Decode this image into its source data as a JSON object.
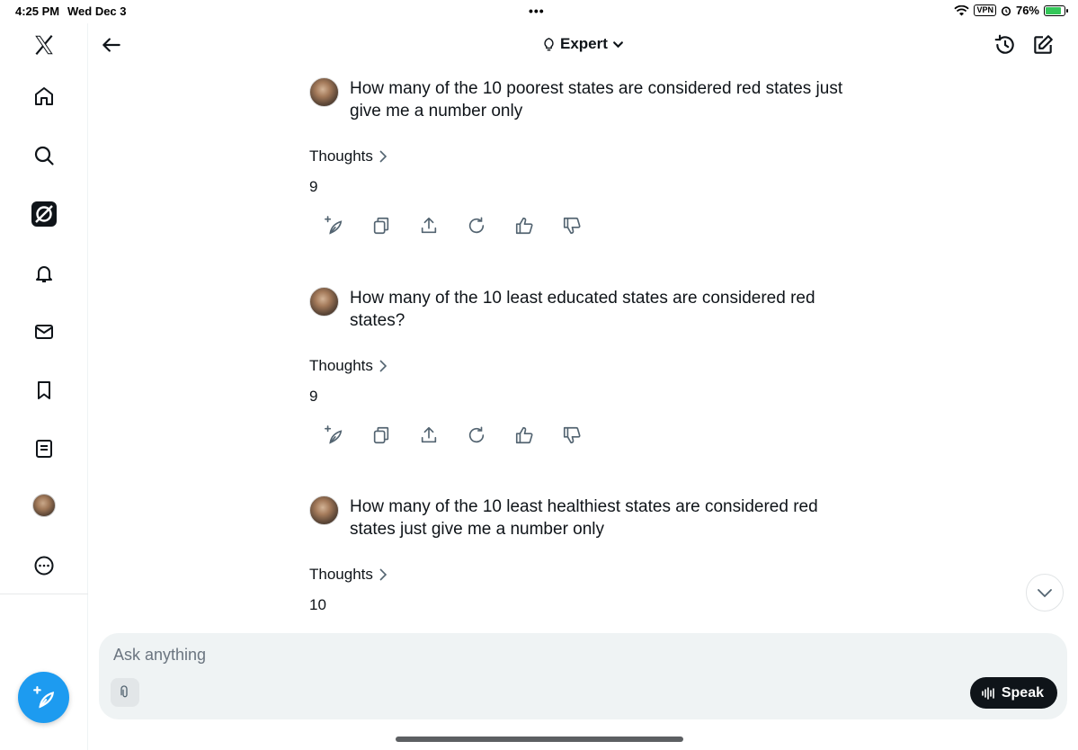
{
  "status_bar": {
    "time": "4:25 PM",
    "date": "Wed Dec 3",
    "dots": "•••",
    "vpn": "VPN",
    "battery_text": "76%",
    "battery_level": 0.76
  },
  "header": {
    "mode_label": "Expert"
  },
  "conversation": [
    {
      "question": "How many of the 10 poorest states are considered red states just give me a number only",
      "thoughts_label": "Thoughts",
      "answer": "9"
    },
    {
      "question": "How many of the 10 least educated states are considered red states?",
      "thoughts_label": "Thoughts",
      "answer": "9"
    },
    {
      "question": "How many of the 10 least healthiest states are considered red states just give me a number only",
      "thoughts_label": "Thoughts",
      "answer": "10"
    }
  ],
  "composer": {
    "placeholder": "Ask anything",
    "speak_label": "Speak"
  },
  "colors": {
    "accent": "#1d9bf0",
    "composer_bg": "#eff3f4",
    "text": "#0f1419"
  }
}
